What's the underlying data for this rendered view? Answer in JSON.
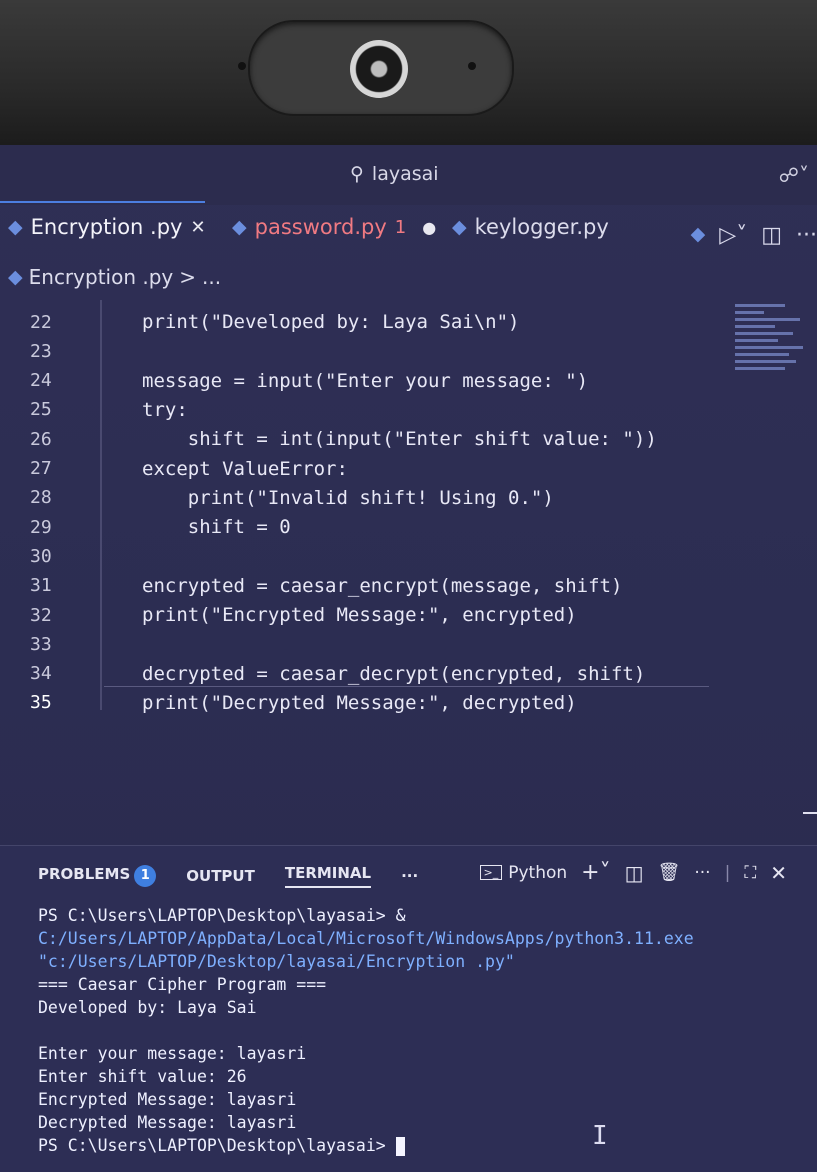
{
  "titlebar": {
    "search_text": "layasai"
  },
  "tabs": [
    {
      "label": "Encryption .py",
      "close": "✕",
      "modified": ""
    },
    {
      "label": "password.py",
      "problems": "1",
      "modified": "●"
    },
    {
      "label": "keylogger.py"
    }
  ],
  "breadcrumb": {
    "file": "Encryption .py",
    "sep": ">",
    "more": "..."
  },
  "editor": {
    "lines": [
      {
        "n": "22",
        "code": "print(\"Developed by: Laya Sai\\n\")"
      },
      {
        "n": "23",
        "code": ""
      },
      {
        "n": "24",
        "code": "message = input(\"Enter your message: \")"
      },
      {
        "n": "25",
        "code": "try:"
      },
      {
        "n": "26",
        "code": "    shift = int(input(\"Enter shift value: \"))"
      },
      {
        "n": "27",
        "code": "except ValueError:"
      },
      {
        "n": "28",
        "code": "    print(\"Invalid shift! Using 0.\")"
      },
      {
        "n": "29",
        "code": "    shift = 0"
      },
      {
        "n": "30",
        "code": ""
      },
      {
        "n": "31",
        "code": "encrypted = caesar_encrypt(message, shift)"
      },
      {
        "n": "32",
        "code": "print(\"Encrypted Message:\", encrypted)"
      },
      {
        "n": "33",
        "code": ""
      },
      {
        "n": "34",
        "code": "decrypted = caesar_decrypt(encrypted, shift)"
      },
      {
        "n": "35",
        "code": "print(\"Decrypted Message:\", decrypted)"
      }
    ]
  },
  "panel": {
    "tabs": {
      "problems": "PROBLEMS",
      "problems_count": "1",
      "output": "OUTPUT",
      "terminal": "TERMINAL",
      "more": "···"
    },
    "shell": "Python",
    "terminal_lines": [
      "PS C:\\Users\\LAPTOP\\Desktop\\layasai> & C:/Users/LAPTOP/AppData/Local/Microsoft/WindowsApps/python3.11.exe \"c:/Users/LAPTOP/Desktop/layasai/Encryption .py\"",
      "=== Caesar Cipher Program ===",
      "Developed by: Laya Sai",
      "",
      "Enter your message: layasri",
      "Enter shift value: 26",
      "Encrypted Message: layasri",
      "Decrypted Message: layasri",
      "PS C:\\Users\\LAPTOP\\Desktop\\layasai> "
    ]
  }
}
